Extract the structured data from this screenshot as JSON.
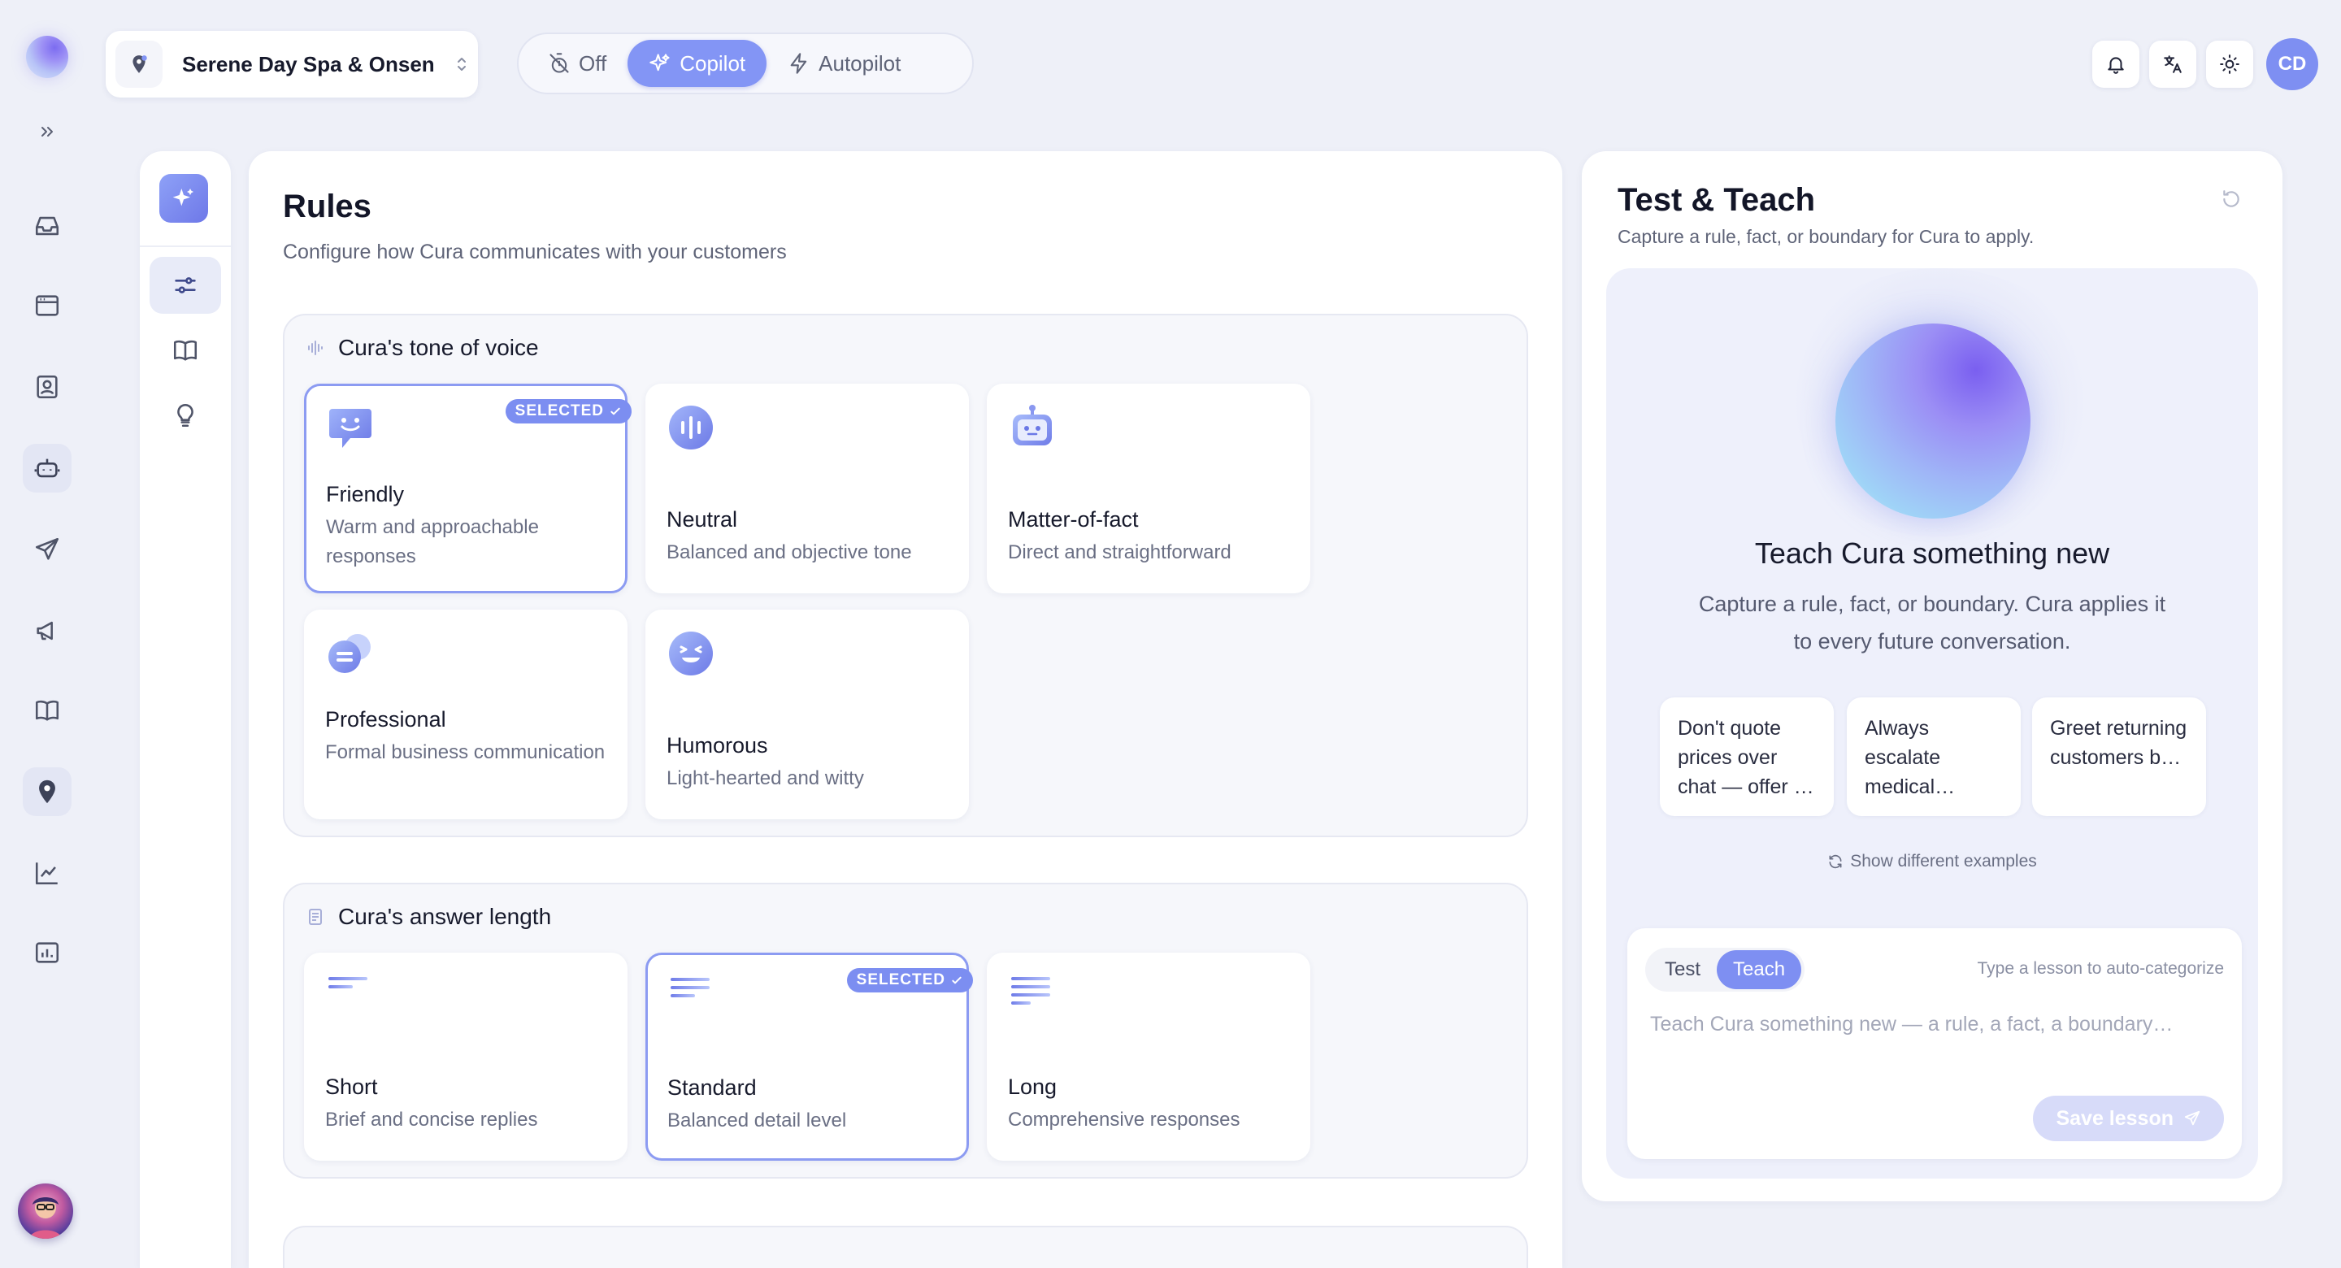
{
  "location": {
    "name": "Serene Day Spa & Onsen"
  },
  "modes": [
    {
      "label": "Off",
      "icon": "timer-off-icon",
      "active": false
    },
    {
      "label": "Copilot",
      "icon": "sparkles-icon",
      "active": true
    },
    {
      "label": "Autopilot",
      "icon": "lightning-icon",
      "active": false
    }
  ],
  "user": {
    "initials": "CD"
  },
  "rail_icons": [
    "inbox-icon",
    "browser-window-icon",
    "contact-card-icon",
    "robot-icon",
    "send-icon",
    "megaphone-icon",
    "book-icon",
    "location-pin-icon",
    "line-chart-icon",
    "report-icon"
  ],
  "rules": {
    "title": "Rules",
    "subtitle": "Configure how Cura communicates with your customers",
    "tone": {
      "heading": "Cura's tone of voice",
      "options": [
        {
          "title": "Friendly",
          "desc": "Warm and approachable responses",
          "selected": true
        },
        {
          "title": "Neutral",
          "desc": "Balanced and objective tone",
          "selected": false
        },
        {
          "title": "Matter-of-fact",
          "desc": "Direct and straightforward",
          "selected": false
        },
        {
          "title": "Professional",
          "desc": "Formal business communication",
          "selected": false
        },
        {
          "title": "Humorous",
          "desc": "Light-hearted and witty",
          "selected": false
        }
      ]
    },
    "length": {
      "heading": "Cura's answer length",
      "options": [
        {
          "title": "Short",
          "desc": "Brief and concise replies",
          "selected": false
        },
        {
          "title": "Standard",
          "desc": "Balanced detail level",
          "selected": true
        },
        {
          "title": "Long",
          "desc": "Comprehensive responses",
          "selected": false
        }
      ]
    },
    "selected_badge": "SELECTED"
  },
  "teach": {
    "title": "Test & Teach",
    "subtitle": "Capture a rule, fact, or boundary for Cura to apply.",
    "hero_title": "Teach Cura something new",
    "hero_desc": "Capture a rule, fact, or boundary. Cura applies it to every future conversation.",
    "examples": [
      "Don't quote prices over chat — offer …",
      "Always escalate medical…",
      "Greet returning customers b…"
    ],
    "show_more": "Show different examples",
    "tabs": [
      {
        "label": "Test",
        "active": false
      },
      {
        "label": "Teach",
        "active": true
      }
    ],
    "hint": "Type a lesson to auto-categorize",
    "placeholder": "Teach Cura something new — a rule, a fact, a boundary…",
    "save_label": "Save lesson"
  }
}
